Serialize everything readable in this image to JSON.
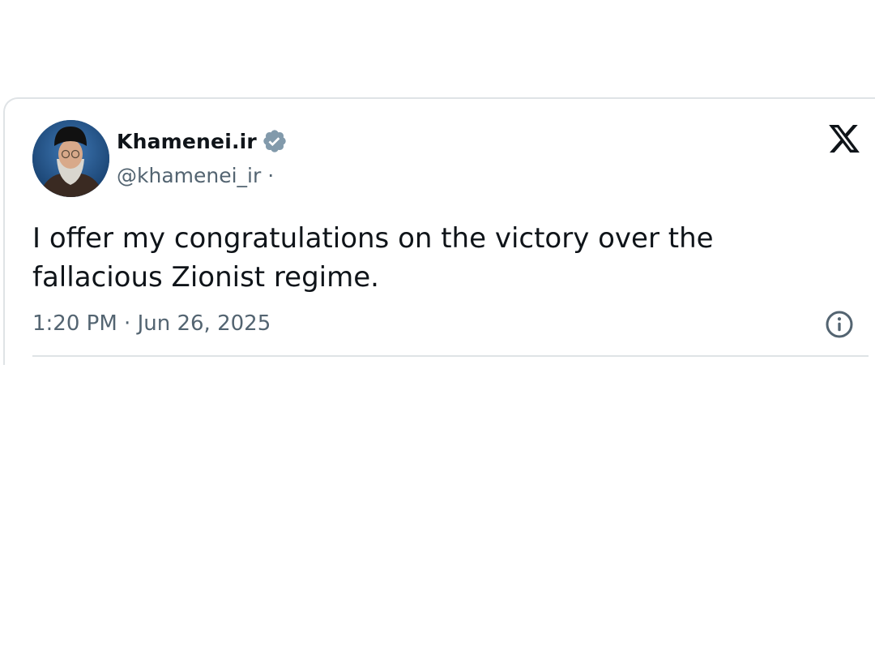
{
  "tweet": {
    "display_name": "Khamenei.ir",
    "handle": "@khamenei_ir",
    "handle_separator": "·",
    "text": "I offer my congratulations on the victory over the fallacious Zionist regime.",
    "time": "1:20 PM",
    "date_separator": "·",
    "date": "Jun 26, 2025"
  },
  "icons": {
    "verified": "verified-badge-icon",
    "platform": "x-logo-icon",
    "info": "info-icon"
  },
  "colors": {
    "text_primary": "#0f1419",
    "text_secondary": "#536471",
    "verified_badge": "#829aab",
    "border": "#dfe3e6"
  }
}
